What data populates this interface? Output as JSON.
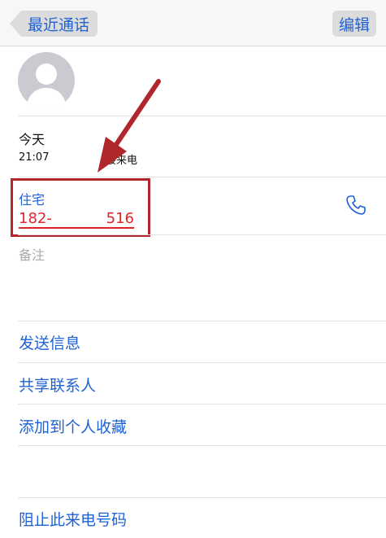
{
  "navbar": {
    "back_label": "最近通话",
    "edit_label": "编辑"
  },
  "recent": {
    "day": "今天",
    "time": "21:07",
    "type": "接来电"
  },
  "phone": {
    "label": "住宅",
    "number_start": "182-",
    "number_end": "516"
  },
  "notes": {
    "label": "备注"
  },
  "actions": {
    "send_message": "发送信息",
    "share_contact": "共享联系人",
    "add_favorite": "添加到个人收藏",
    "block_caller": "阻止此来电号码"
  },
  "colors": {
    "accent": "#1e62d6",
    "highlight": "#b0262b",
    "number": "#e0262b"
  }
}
